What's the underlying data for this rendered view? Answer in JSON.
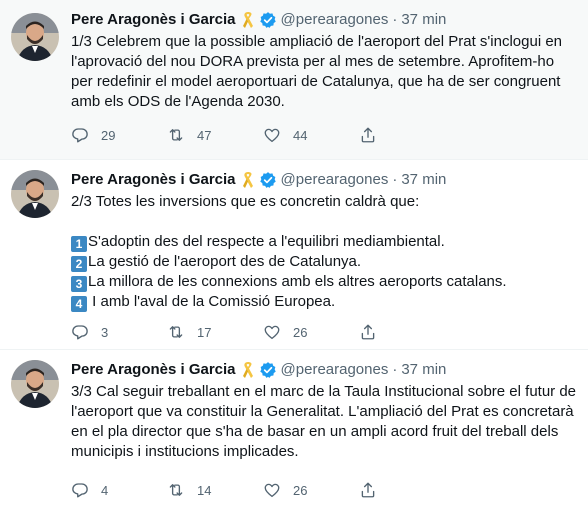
{
  "author": {
    "name": "Pere Aragonès i Garcia",
    "handle": "@perearagones"
  },
  "colors": {
    "text": "#0f1419",
    "muted": "#536471",
    "verified": "#1d9bf0",
    "ribbon": "#f5c542",
    "keycap": "#3b88c3",
    "highlight_bg": "#f7f9f9"
  },
  "icons": [
    "yellow-ribbon-icon",
    "verified-badge-icon",
    "reply-icon",
    "retweet-icon",
    "like-icon",
    "share-icon",
    "keycap-digit-icon"
  ],
  "tweets": [
    {
      "time": "37 min",
      "lines": [
        "1/3 Celebrem que la possible ampliació de l'aeroport del Prat s'inclogui en",
        "l'aprovació del nou DORA prevista per al mes de setembre. Aprofitem-ho",
        "per redefinir el model aeroportuari de Catalunya, que ha de ser congruent",
        "amb els ODS de l'Agenda 2030."
      ],
      "replies": "29",
      "retweets": "47",
      "likes": "44"
    },
    {
      "time": "37 min",
      "intro": "2/3 Totes les inversions que es concretin caldrà que:",
      "items": [
        {
          "n": "1",
          "text": "S'adoptin des del respecte a l'equilibri mediambiental."
        },
        {
          "n": "2",
          "text": "La gestió de l'aeroport des de Catalunya."
        },
        {
          "n": "3",
          "text": "La millora de les connexions amb els altres aeroports catalans."
        },
        {
          "n": "4",
          "text": " I amb l'aval de la Comissió Europea."
        }
      ],
      "replies": "3",
      "retweets": "17",
      "likes": "26"
    },
    {
      "time": "37 min",
      "lines": [
        "3/3 Cal seguir treballant en el marc de la Taula Institucional sobre el futur de",
        "l'aeroport que va constituir la Generalitat. L'ampliació del Prat es concretarà",
        "en el pla director que s'ha de basar en un ampli acord fruit del treball dels",
        "municipis i institucions implicades."
      ],
      "replies": "4",
      "retweets": "14",
      "likes": "26"
    }
  ]
}
